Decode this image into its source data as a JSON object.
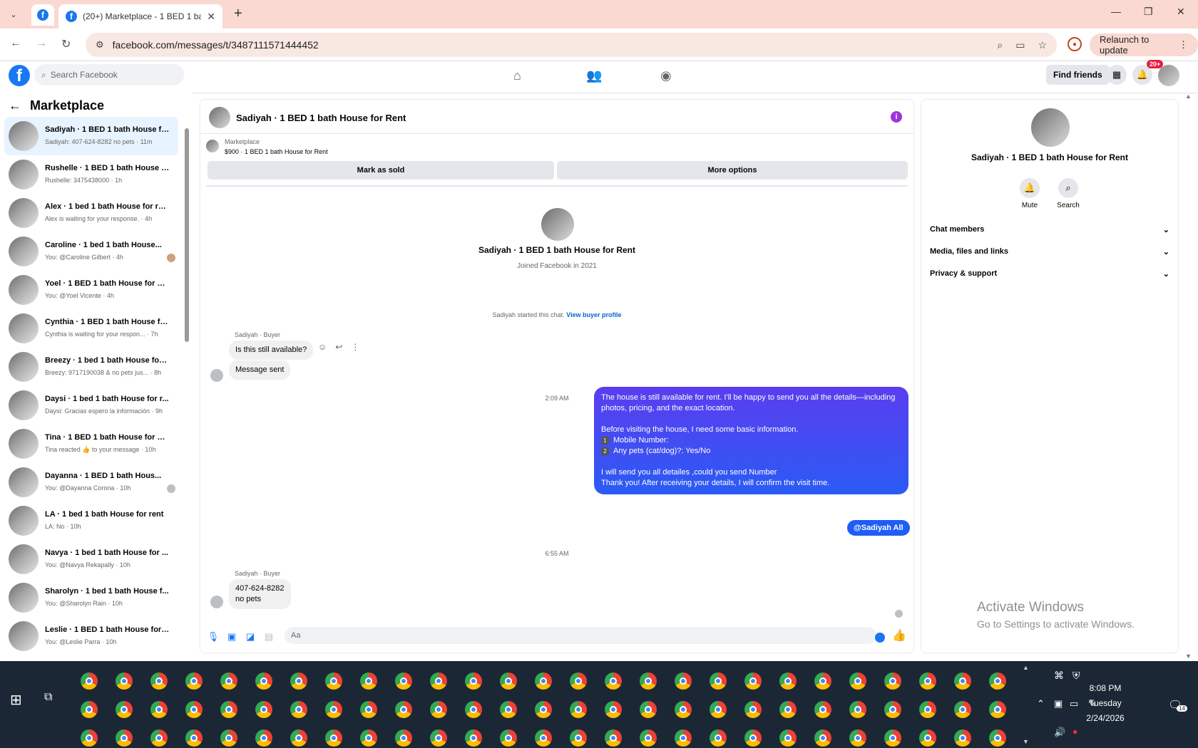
{
  "browser": {
    "tab_title": "(20+) Marketplace - 1 BED 1 ba",
    "url": "facebook.com/messages/t/3487111571444452",
    "relaunch_label": "Relaunch to update"
  },
  "fb": {
    "search_placeholder": "Search Facebook",
    "find_friends": "Find friends",
    "notif_count": "20+"
  },
  "left": {
    "title": "Marketplace",
    "conversations": [
      {
        "name": "Sadiyah · 1 BED 1 bath House fo...",
        "preview": "Sadiyah: 407-624-8282 no pets · 11m"
      },
      {
        "name": "Rushelle · 1 BED 1 bath House f...",
        "preview": "Rushelle: 3475438000 · 1h"
      },
      {
        "name": "Alex · 1 bed 1 bath House for rent",
        "preview": "Alex is waiting for your response. · 4h"
      },
      {
        "name": "Caroline · 1 bed 1 bath House...",
        "preview": "You: @Caroline Gilbert · 4h"
      },
      {
        "name": "Yoel · 1 BED 1 bath House for Re...",
        "preview": "You: @Yoel Vicente · 4h"
      },
      {
        "name": "Cynthia · 1 BED 1 bath House fo...",
        "preview": "Cynthia is waiting for your respon... · 7h"
      },
      {
        "name": "Breezy · 1 bed 1 bath House for ...",
        "preview": "Breezy: 9717190038 & no pets jus... · 8h"
      },
      {
        "name": "Daysi · 1 bed 1 bath House for r...",
        "preview": "Daysi: Gracias espero la información · 9h"
      },
      {
        "name": "Tina · 1 BED 1 bath House for Re...",
        "preview": "Tina reacted 👍 to your message · 10h"
      },
      {
        "name": "Dayanna · 1 BED 1 bath Hous...",
        "preview": "You: @Dayanna Corona · 10h"
      },
      {
        "name": "LA · 1 bed 1 bath House for rent",
        "preview": "LA: No · 10h"
      },
      {
        "name": "Navya · 1 bed 1 bath House for ...",
        "preview": "You: @Navya Rekapally · 10h"
      },
      {
        "name": "Sharolyn · 1 bed 1 bath House f...",
        "preview": "You: @Sharolyn Rain · 10h"
      },
      {
        "name": "Leslie · 1 BED 1 bath House for ...",
        "preview": "You: @Leslie Parra · 10h"
      }
    ]
  },
  "chat": {
    "title": "Sadiyah · 1 BED 1 bath House for Rent",
    "mp_label": "Marketplace",
    "mp_price": "$900 · 1 BED 1 bath House for Rent",
    "mark_sold": "Mark as sold",
    "more_options": "More options",
    "intro_name": "Sadiyah · 1 BED 1 bath House for Rent",
    "intro_joined": "Joined Facebook in 2021",
    "started_text": "Sadiyah started this chat.",
    "buyer_profile_link": "View buyer profile",
    "sender_label": "Sadiyah · Buyer",
    "msg1": "Is this still available?",
    "msg2": "Message sent",
    "time1": "2:09 AM",
    "out_p1": "The house is still available for rent. I'll be happy to send you all the details—including photos, pricing, and the exact location.",
    "out_p2_line1": "Before visiting the house, I need some basic information.",
    "out_item1": "Mobile Number:",
    "out_item2": "Any pets (cat/dog)?: Yes/No",
    "out_p3_line1": "I will send you all detailes ,could you send Number",
    "out_p3_line2": "Thank you! After receiving your details, I will confirm the visit time.",
    "out_tag": "@Sadiyah All",
    "time2": "6:55 AM",
    "msg3_line1": "407-624-8282",
    "msg3_line2": "no pets",
    "composer_placeholder": "Aa"
  },
  "right": {
    "name": "Sadiyah · 1 BED 1 bath House for Rent",
    "mute": "Mute",
    "search": "Search",
    "rows": [
      "Chat members",
      "Media, files and links",
      "Privacy & support"
    ]
  },
  "watermark": {
    "line1": "Activate Windows",
    "line2": "Go to Settings to activate Windows."
  },
  "taskbar": {
    "time": "8:08 PM",
    "day": "Tuesday",
    "date": "2/24/2026",
    "notif_count": "14"
  }
}
